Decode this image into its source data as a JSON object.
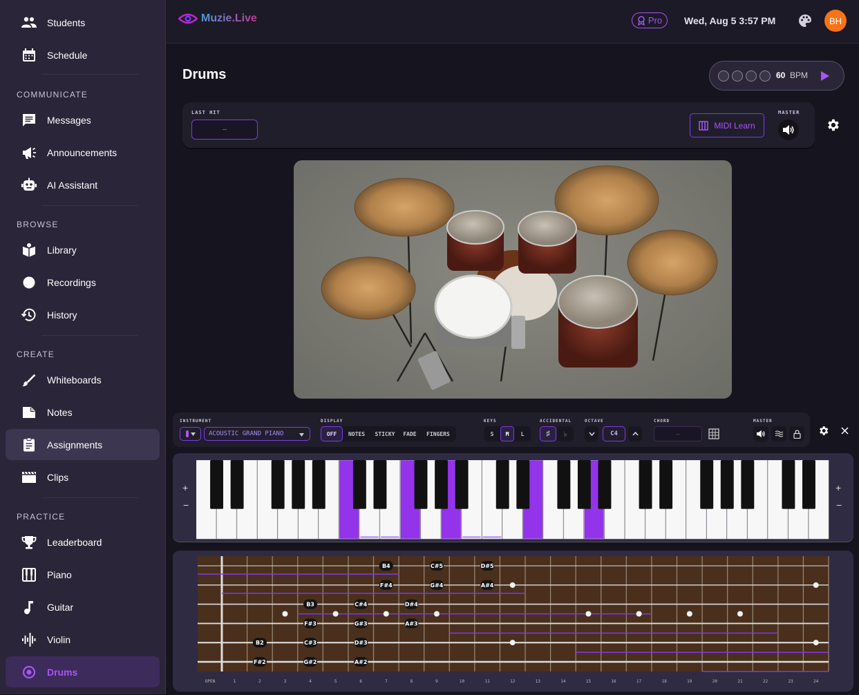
{
  "sidebar": {
    "items_top": [
      {
        "label": "Students",
        "icon": "people-icon"
      },
      {
        "label": "Schedule",
        "icon": "calendar-icon"
      }
    ],
    "sections": [
      {
        "title": "COMMUNICATE",
        "items": [
          {
            "label": "Messages",
            "icon": "message-icon"
          },
          {
            "label": "Announcements",
            "icon": "megaphone-icon"
          },
          {
            "label": "AI Assistant",
            "icon": "robot-icon"
          }
        ]
      },
      {
        "title": "BROWSE",
        "items": [
          {
            "label": "Library",
            "icon": "library-icon"
          },
          {
            "label": "Recordings",
            "icon": "record-icon"
          },
          {
            "label": "History",
            "icon": "history-icon"
          }
        ]
      },
      {
        "title": "CREATE",
        "items": [
          {
            "label": "Whiteboards",
            "icon": "brush-icon"
          },
          {
            "label": "Notes",
            "icon": "note-icon"
          },
          {
            "label": "Assignments",
            "icon": "clipboard-icon"
          },
          {
            "label": "Clips",
            "icon": "clapper-icon"
          }
        ]
      },
      {
        "title": "PRACTICE",
        "items": [
          {
            "label": "Leaderboard",
            "icon": "trophy-icon"
          },
          {
            "label": "Piano",
            "icon": "piano-icon"
          },
          {
            "label": "Guitar",
            "icon": "guitar-icon"
          },
          {
            "label": "Violin",
            "icon": "waveform-icon"
          },
          {
            "label": "Drums",
            "icon": "drum-icon"
          }
        ]
      }
    ]
  },
  "topbar": {
    "logo_text": "Muzie.Live",
    "pro_label": "Pro",
    "datetime": "Wed, Aug 5 3:57 PM",
    "avatar_initials": "BH"
  },
  "page": {
    "title": "Drums"
  },
  "metronome": {
    "bpm_value": "60",
    "bpm_unit": "BPM",
    "beats": 4
  },
  "drum_panel": {
    "last_hit_label": "LAST HIT",
    "last_hit_value": "–",
    "midi_learn_label": "MIDI Learn",
    "master_label": "MASTER"
  },
  "piano_toolbar": {
    "instrument_label": "INSTRUMENT",
    "instrument_value": "ACOUSTIC GRAND PIANO",
    "display_label": "DISPLAY",
    "display_options": [
      "OFF",
      "NOTES",
      "STICKY",
      "FADE",
      "FINGERS"
    ],
    "display_selected": "OFF",
    "keys_label": "KEYS",
    "key_sizes": [
      "S",
      "M",
      "L"
    ],
    "key_size_selected": "M",
    "accidental_label": "ACCIDENTAL",
    "accidentals": [
      "♯",
      "♭"
    ],
    "octave_label": "OCTAVE",
    "octave_value": "C4",
    "chord_label": "CHORD",
    "chord_value": "–",
    "master_label": "MASTER"
  },
  "keyboard": {
    "zoom_in": "+",
    "zoom_out": "−"
  },
  "fretboard": {
    "fret_numbers": [
      "OPEN",
      "1",
      "2",
      "3",
      "4",
      "5",
      "6",
      "7",
      "8",
      "9",
      "10",
      "11",
      "12",
      "13",
      "14",
      "15",
      "16",
      "17",
      "18",
      "19",
      "20",
      "21",
      "22",
      "23",
      "24"
    ],
    "note_labels": [
      {
        "fret": 7,
        "string": 0,
        "note": "B4"
      },
      {
        "fret": 9,
        "string": 0,
        "note": "C#5"
      },
      {
        "fret": 11,
        "string": 0,
        "note": "D#5"
      },
      {
        "fret": 7,
        "string": 1,
        "note": "F#4"
      },
      {
        "fret": 9,
        "string": 1,
        "note": "G#4"
      },
      {
        "fret": 11,
        "string": 1,
        "note": "A#4"
      },
      {
        "fret": 4,
        "string": 2,
        "note": "B3"
      },
      {
        "fret": 6,
        "string": 2,
        "note": "C#4"
      },
      {
        "fret": 8,
        "string": 2,
        "note": "D#4"
      },
      {
        "fret": 4,
        "string": 3,
        "note": "F#3"
      },
      {
        "fret": 6,
        "string": 3,
        "note": "G#3"
      },
      {
        "fret": 8,
        "string": 3,
        "note": "A#3"
      },
      {
        "fret": 2,
        "string": 4,
        "note": "B2"
      },
      {
        "fret": 4,
        "string": 4,
        "note": "C#3"
      },
      {
        "fret": 6,
        "string": 4,
        "note": "D#3"
      },
      {
        "fret": 2,
        "string": 5,
        "note": "F#2"
      },
      {
        "fret": 4,
        "string": 5,
        "note": "G#2"
      },
      {
        "fret": 6,
        "string": 5,
        "note": "A#2"
      }
    ]
  },
  "colors": {
    "accent": "#a855f7",
    "key_highlight": "#9333ea",
    "sidebar_bg": "#2a2538",
    "fretboard_wood": "#4a2f1d",
    "avatar": "#f97316"
  }
}
